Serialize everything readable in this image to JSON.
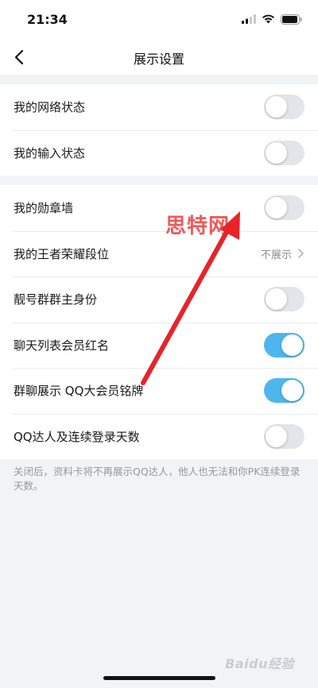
{
  "status_bar": {
    "time": "21:34"
  },
  "nav": {
    "title": "展示设置"
  },
  "group1": [
    {
      "label": "我的网络状态",
      "on": false
    },
    {
      "label": "我的输入状态",
      "on": false
    }
  ],
  "group2": {
    "badge_wall": {
      "label": "我的勋章墙",
      "on": false
    },
    "game_rank": {
      "label": "我的王者荣耀段位",
      "value": "不展示"
    },
    "group_owner": {
      "label": "靓号群群主身份",
      "on": false
    },
    "chat_list_vip": {
      "label": "聊天列表会员红名",
      "on": true
    },
    "group_chat_plaque": {
      "label": "群聊展示 QQ大会员铭牌",
      "on": true
    },
    "qq_master": {
      "label": "QQ达人及连续登录天数",
      "on": false
    }
  },
  "footer_note": "关闭后，资料卡将不再展示QQ达人，他人也无法和你PK连续登录天数。",
  "watermark": "思特网",
  "baidu_mark": "Baidu经验",
  "colors": {
    "toggle_on": "#4eb6ee",
    "toggle_off": "#e4e5ea",
    "arrow": "#e8232a"
  }
}
